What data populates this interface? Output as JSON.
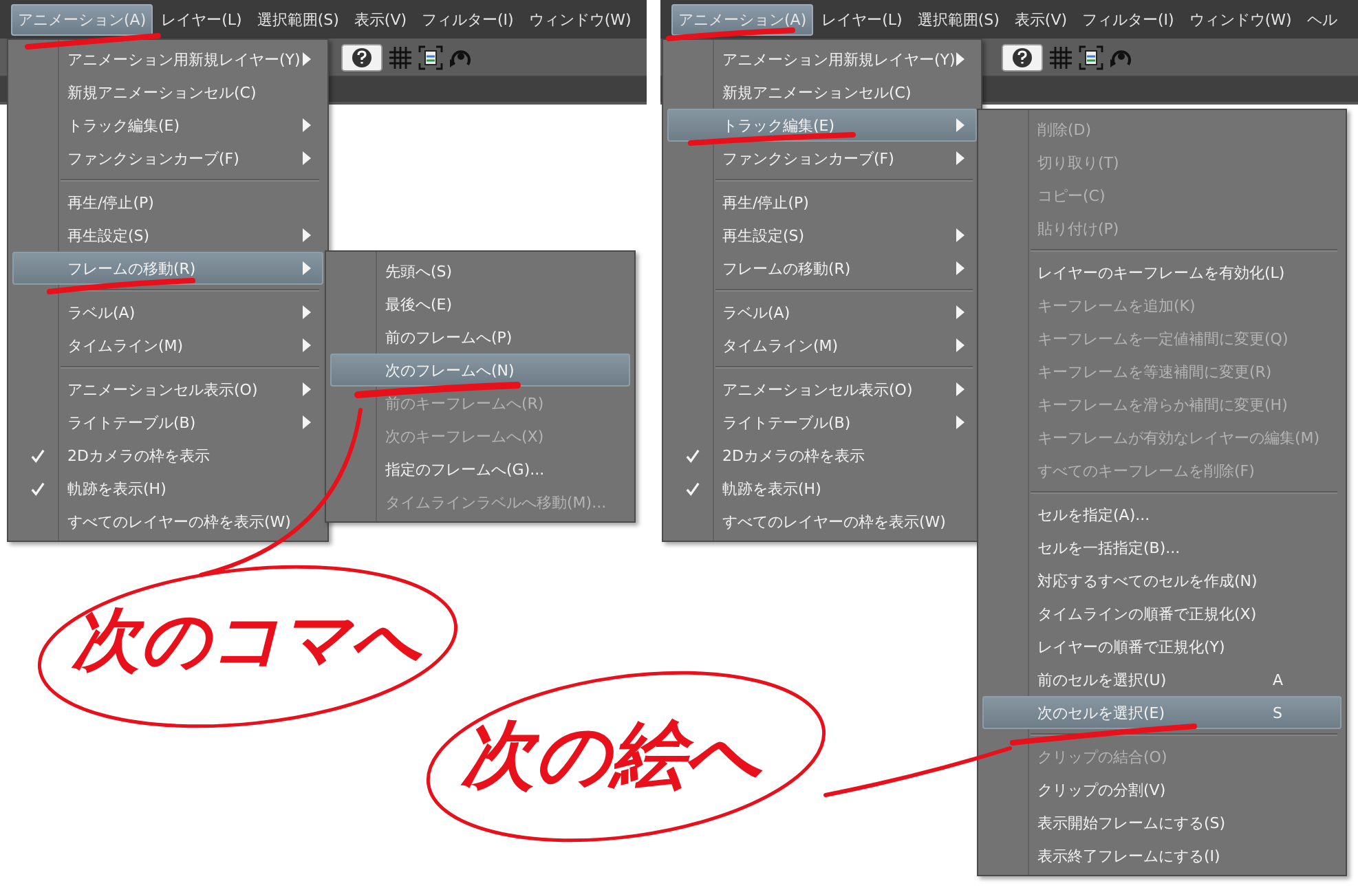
{
  "panels": [
    {
      "menubar": [
        {
          "label": "アニメーション(A)",
          "selected": true
        },
        {
          "label": "レイヤー(L)",
          "selected": false
        },
        {
          "label": "選択範囲(S)",
          "selected": false
        },
        {
          "label": "表示(V)",
          "selected": false
        },
        {
          "label": "フィルター(I)",
          "selected": false
        },
        {
          "label": "ウィンドウ(W)",
          "selected": false
        }
      ],
      "menu": [
        {
          "kind": "item",
          "label": "アニメーション用新規レイヤー(Y)",
          "submenu": true,
          "checked": false,
          "selected": false
        },
        {
          "kind": "item",
          "label": "新規アニメーションセル(C)",
          "submenu": false,
          "checked": false,
          "selected": false
        },
        {
          "kind": "item",
          "label": "トラック編集(E)",
          "submenu": true,
          "checked": false,
          "selected": false
        },
        {
          "kind": "item",
          "label": "ファンクションカーブ(F)",
          "submenu": true,
          "checked": false,
          "selected": false
        },
        {
          "kind": "separator"
        },
        {
          "kind": "item",
          "label": "再生/停止(P)",
          "submenu": false,
          "checked": false,
          "selected": false
        },
        {
          "kind": "item",
          "label": "再生設定(S)",
          "submenu": true,
          "checked": false,
          "selected": false
        },
        {
          "kind": "item",
          "label": "フレームの移動(R)",
          "submenu": true,
          "checked": false,
          "selected": true
        },
        {
          "kind": "separator"
        },
        {
          "kind": "item",
          "label": "ラベル(A)",
          "submenu": true,
          "checked": false,
          "selected": false
        },
        {
          "kind": "item",
          "label": "タイムライン(M)",
          "submenu": true,
          "checked": false,
          "selected": false
        },
        {
          "kind": "separator"
        },
        {
          "kind": "item",
          "label": "アニメーションセル表示(O)",
          "submenu": true,
          "checked": false,
          "selected": false
        },
        {
          "kind": "item",
          "label": "ライトテーブル(B)",
          "submenu": true,
          "checked": false,
          "selected": false
        },
        {
          "kind": "item",
          "label": "2Dカメラの枠を表示",
          "submenu": false,
          "checked": true,
          "selected": false
        },
        {
          "kind": "item",
          "label": "軌跡を表示(H)",
          "submenu": false,
          "checked": true,
          "selected": false
        },
        {
          "kind": "item",
          "label": "すべてのレイヤーの枠を表示(W)",
          "submenu": false,
          "checked": false,
          "selected": false
        }
      ],
      "submenu": [
        {
          "kind": "item",
          "label": "先頭へ(S)",
          "disabled": false,
          "selected": false
        },
        {
          "kind": "item",
          "label": "最後へ(E)",
          "disabled": false,
          "selected": false
        },
        {
          "kind": "item",
          "label": "前のフレームへ(P)",
          "disabled": false,
          "selected": false
        },
        {
          "kind": "item",
          "label": "次のフレームへ(N)",
          "disabled": false,
          "selected": true
        },
        {
          "kind": "item",
          "label": "前のキーフレームへ(R)",
          "disabled": true,
          "selected": false
        },
        {
          "kind": "item",
          "label": "次のキーフレームへ(X)",
          "disabled": true,
          "selected": false
        },
        {
          "kind": "item",
          "label": "指定のフレームへ(G)...",
          "disabled": false,
          "selected": false
        },
        {
          "kind": "item",
          "label": "タイムラインラベルへ移動(M)...",
          "disabled": true,
          "selected": false
        }
      ]
    },
    {
      "menubar": [
        {
          "label": "アニメーション(A)",
          "selected": true
        },
        {
          "label": "レイヤー(L)",
          "selected": false
        },
        {
          "label": "選択範囲(S)",
          "selected": false
        },
        {
          "label": "表示(V)",
          "selected": false
        },
        {
          "label": "フィルター(I)",
          "selected": false
        },
        {
          "label": "ウィンドウ(W)",
          "selected": false
        },
        {
          "label": "ヘル",
          "selected": false
        }
      ],
      "menu": [
        {
          "kind": "item",
          "label": "アニメーション用新規レイヤー(Y)",
          "submenu": true,
          "checked": false,
          "selected": false
        },
        {
          "kind": "item",
          "label": "新規アニメーションセル(C)",
          "submenu": false,
          "checked": false,
          "selected": false
        },
        {
          "kind": "item",
          "label": "トラック編集(E)",
          "submenu": true,
          "checked": false,
          "selected": true
        },
        {
          "kind": "item",
          "label": "ファンクションカーブ(F)",
          "submenu": true,
          "checked": false,
          "selected": false
        },
        {
          "kind": "separator"
        },
        {
          "kind": "item",
          "label": "再生/停止(P)",
          "submenu": false,
          "checked": false,
          "selected": false
        },
        {
          "kind": "item",
          "label": "再生設定(S)",
          "submenu": true,
          "checked": false,
          "selected": false
        },
        {
          "kind": "item",
          "label": "フレームの移動(R)",
          "submenu": true,
          "checked": false,
          "selected": false
        },
        {
          "kind": "separator"
        },
        {
          "kind": "item",
          "label": "ラベル(A)",
          "submenu": true,
          "checked": false,
          "selected": false
        },
        {
          "kind": "item",
          "label": "タイムライン(M)",
          "submenu": true,
          "checked": false,
          "selected": false
        },
        {
          "kind": "separator"
        },
        {
          "kind": "item",
          "label": "アニメーションセル表示(O)",
          "submenu": true,
          "checked": false,
          "selected": false
        },
        {
          "kind": "item",
          "label": "ライトテーブル(B)",
          "submenu": true,
          "checked": false,
          "selected": false
        },
        {
          "kind": "item",
          "label": "2Dカメラの枠を表示",
          "submenu": false,
          "checked": true,
          "selected": false
        },
        {
          "kind": "item",
          "label": "軌跡を表示(H)",
          "submenu": false,
          "checked": true,
          "selected": false
        },
        {
          "kind": "item",
          "label": "すべてのレイヤーの枠を表示(W)",
          "submenu": false,
          "checked": false,
          "selected": false
        }
      ],
      "submenu": [
        {
          "kind": "item",
          "label": "削除(D)",
          "disabled": true,
          "selected": false
        },
        {
          "kind": "item",
          "label": "切り取り(T)",
          "disabled": true,
          "selected": false
        },
        {
          "kind": "item",
          "label": "コピー(C)",
          "disabled": true,
          "selected": false
        },
        {
          "kind": "item",
          "label": "貼り付け(P)",
          "disabled": true,
          "selected": false
        },
        {
          "kind": "separator"
        },
        {
          "kind": "item",
          "label": "レイヤーのキーフレームを有効化(L)",
          "disabled": false,
          "selected": false
        },
        {
          "kind": "item",
          "label": "キーフレームを追加(K)",
          "disabled": true,
          "selected": false
        },
        {
          "kind": "item",
          "label": "キーフレームを一定値補間に変更(Q)",
          "disabled": true,
          "selected": false
        },
        {
          "kind": "item",
          "label": "キーフレームを等速補間に変更(R)",
          "disabled": true,
          "selected": false
        },
        {
          "kind": "item",
          "label": "キーフレームを滑らか補間に変更(H)",
          "disabled": true,
          "selected": false
        },
        {
          "kind": "item",
          "label": "キーフレームが有効なレイヤーの編集(M)",
          "disabled": true,
          "selected": false
        },
        {
          "kind": "item",
          "label": "すべてのキーフレームを削除(F)",
          "disabled": true,
          "selected": false
        },
        {
          "kind": "separator"
        },
        {
          "kind": "item",
          "label": "セルを指定(A)...",
          "disabled": false,
          "selected": false
        },
        {
          "kind": "item",
          "label": "セルを一括指定(B)...",
          "disabled": false,
          "selected": false
        },
        {
          "kind": "item",
          "label": "対応するすべてのセルを作成(N)",
          "disabled": false,
          "selected": false
        },
        {
          "kind": "item",
          "label": "タイムラインの順番で正規化(X)",
          "disabled": false,
          "selected": false
        },
        {
          "kind": "item",
          "label": "レイヤーの順番で正規化(Y)",
          "disabled": false,
          "selected": false
        },
        {
          "kind": "item",
          "label": "前のセルを選択(U)",
          "shortcut": "A",
          "disabled": false,
          "selected": false
        },
        {
          "kind": "item",
          "label": "次のセルを選択(E)",
          "shortcut": "S",
          "disabled": false,
          "selected": true
        },
        {
          "kind": "separator"
        },
        {
          "kind": "item",
          "label": "クリップの結合(O)",
          "disabled": true,
          "selected": false
        },
        {
          "kind": "item",
          "label": "クリップの分割(V)",
          "disabled": false,
          "selected": false
        },
        {
          "kind": "item",
          "label": "表示開始フレームにする(S)",
          "disabled": false,
          "selected": false
        },
        {
          "kind": "item",
          "label": "表示終了フレームにする(I)",
          "disabled": false,
          "selected": false
        }
      ]
    }
  ],
  "annotations": [
    {
      "text": "次のコマへ"
    },
    {
      "text": "次の絵へ"
    }
  ]
}
